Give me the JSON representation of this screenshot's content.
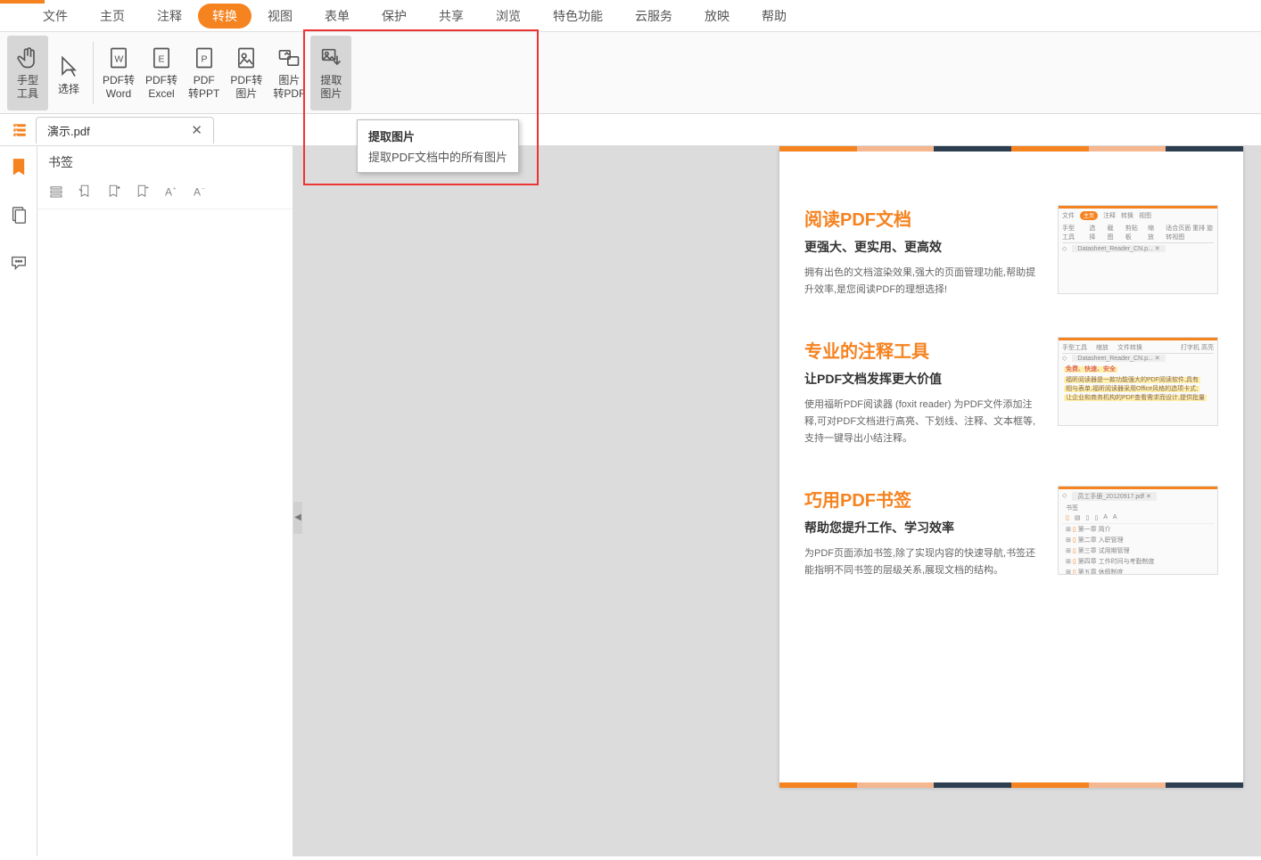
{
  "menu": [
    "文件",
    "主页",
    "注释",
    "转换",
    "视图",
    "表单",
    "保护",
    "共享",
    "浏览",
    "特色功能",
    "云服务",
    "放映",
    "帮助"
  ],
  "menu_active": 3,
  "ribbon": [
    {
      "label": "手型\n工具",
      "name": "hand-tool"
    },
    {
      "label": "选择",
      "name": "select-tool"
    },
    {
      "label": "PDF转\nWord",
      "name": "pdf-to-word"
    },
    {
      "label": "PDF转\nExcel",
      "name": "pdf-to-excel"
    },
    {
      "label": "PDF\n转PPT",
      "name": "pdf-to-ppt"
    },
    {
      "label": "PDF转\n图片",
      "name": "pdf-to-image"
    },
    {
      "label": "图片\n转PDF",
      "name": "image-to-pdf"
    },
    {
      "label": "提取\n图片",
      "name": "extract-images"
    }
  ],
  "doc_tab": "演示.pdf",
  "bookmark_title": "书签",
  "tooltip": {
    "title": "提取图片",
    "desc": "提取PDF文档中的所有图片"
  },
  "features": [
    {
      "title": "阅读PDF文档",
      "subtitle": "更强大、更实用、更高效",
      "body": "拥有出色的文档渲染效果,强大的页面管理功能,帮助提升效率,是您阅读PDF的理想选择!",
      "thumb_tab": "Datasheet_Reader_CN.p..."
    },
    {
      "title": "专业的注释工具",
      "subtitle": "让PDF文档发挥更大价值",
      "body": "使用福昕PDF阅读器 (foxit reader) 为PDF文件添加注释,可对PDF文档进行高亮、下划线、注释、文本框等,支持一键导出小结注释。",
      "thumb_tab": "Datasheet_Reader_CN.p...",
      "hl1": "免费、快速、安全",
      "hl2": "福昕阅读器是一款功能强大的PDF阅读软件,具有"
    },
    {
      "title": "巧用PDF书签",
      "subtitle": "帮助您提升工作、学习效率",
      "body": "为PDF页面添加书签,除了实现内容的快速导航,书签还能指明不同书签的层级关系,展现文档的结构。",
      "thumb_tab": "员工手册_20120917.pdf",
      "toc": [
        "第一章  简介",
        "第二章  入职管理",
        "第三章  试用期管理",
        "第四章  工作时间与考勤制度",
        "第五章  休假制度"
      ]
    }
  ],
  "stripe": [
    "#f58320",
    "#f5b790",
    "#2c3e50",
    "#f58320",
    "#f5b790",
    "#2c3e50"
  ],
  "mini_menu": [
    "文件",
    "主页",
    "注释",
    "转换",
    "视图"
  ],
  "mini_tools": [
    "手型工具",
    "选择",
    "截图",
    "剪贴板",
    "缩放"
  ],
  "mini_right": [
    "适合页面",
    "重排",
    "旋转视图"
  ],
  "mini_tools2": [
    "手型工具",
    "缩放",
    "文件转换"
  ],
  "mini_right2": [
    "打字机",
    "高亮"
  ],
  "bm_label": "书签"
}
